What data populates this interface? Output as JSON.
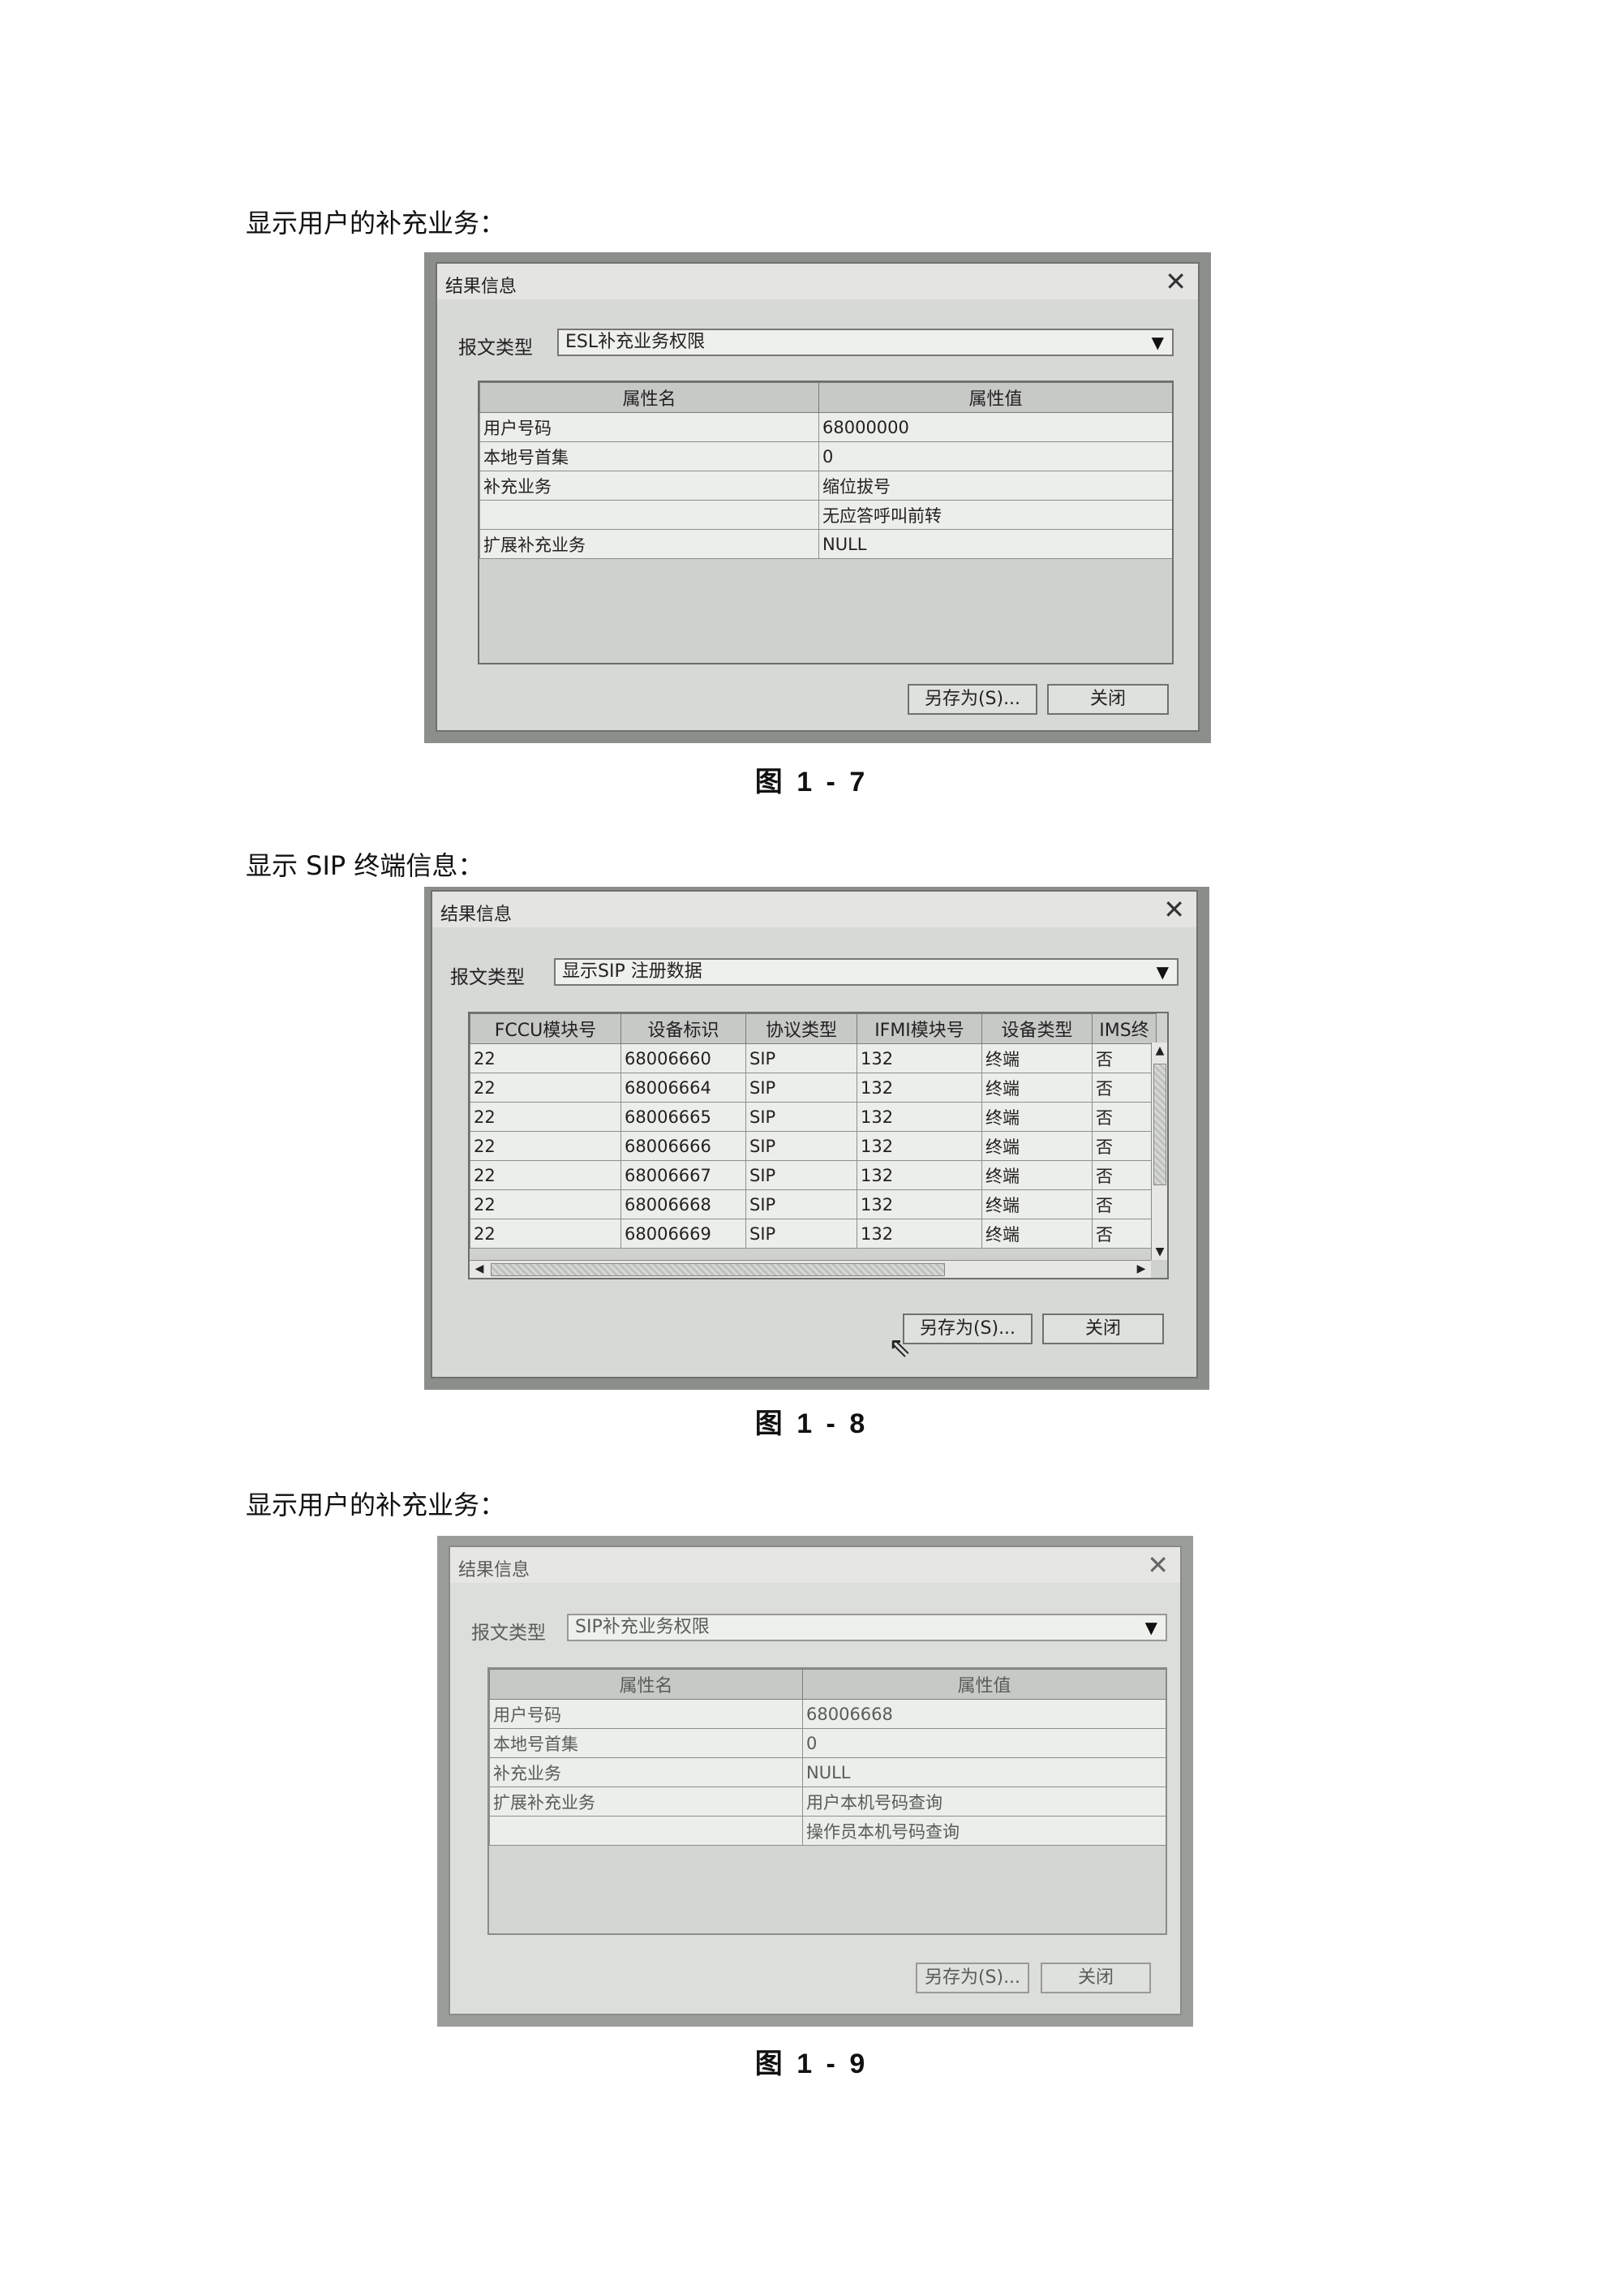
{
  "sections": [
    {
      "heading": "显示用户的补充业务：",
      "dialog": {
        "title": "结果信息",
        "msg_type_label": "报文类型",
        "msg_type_value": "ESL补充业务权限",
        "columns": [
          "属性名",
          "属性值"
        ],
        "rows": [
          [
            "用户号码",
            "68000000"
          ],
          [
            "本地号首集",
            "0"
          ],
          [
            "补充业务",
            "缩位拔号"
          ],
          [
            "",
            "无应答呼叫前转"
          ],
          [
            "扩展补充业务",
            "NULL"
          ]
        ],
        "save_as": "另存为(S)...",
        "close": "关闭"
      },
      "caption": "图 1 - 7"
    },
    {
      "heading": "显示 SIP 终端信息：",
      "dialog": {
        "title": "结果信息",
        "msg_type_label": "报文类型",
        "msg_type_value": "显示SIP 注册数据",
        "columns": [
          "FCCU模块号",
          "设备标识",
          "协议类型",
          "IFMI模块号",
          "设备类型",
          "IMS终"
        ],
        "rows": [
          [
            "22",
            "68006660",
            "SIP",
            "132",
            "终端",
            "否"
          ],
          [
            "22",
            "68006664",
            "SIP",
            "132",
            "终端",
            "否"
          ],
          [
            "22",
            "68006665",
            "SIP",
            "132",
            "终端",
            "否"
          ],
          [
            "22",
            "68006666",
            "SIP",
            "132",
            "终端",
            "否"
          ],
          [
            "22",
            "68006667",
            "SIP",
            "132",
            "终端",
            "否"
          ],
          [
            "22",
            "68006668",
            "SIP",
            "132",
            "终端",
            "否"
          ],
          [
            "22",
            "68006669",
            "SIP",
            "132",
            "终端",
            "否"
          ]
        ],
        "save_as": "另存为(S)...",
        "close": "关闭"
      },
      "caption": "图 1 - 8"
    },
    {
      "heading": "显示用户的补充业务：",
      "dialog": {
        "title": "结果信息",
        "msg_type_label": "报文类型",
        "msg_type_value": "SIP补充业务权限",
        "columns": [
          "属性名",
          "属性值"
        ],
        "rows": [
          [
            "用户号码",
            "68006668"
          ],
          [
            "本地号首集",
            "0"
          ],
          [
            "补充业务",
            "NULL"
          ],
          [
            "扩展补充业务",
            "用户本机号码查询"
          ],
          [
            "",
            "操作员本机号码查询"
          ]
        ],
        "save_as": "另存为(S)...",
        "close": "关闭"
      },
      "caption": "图 1 - 9"
    }
  ]
}
